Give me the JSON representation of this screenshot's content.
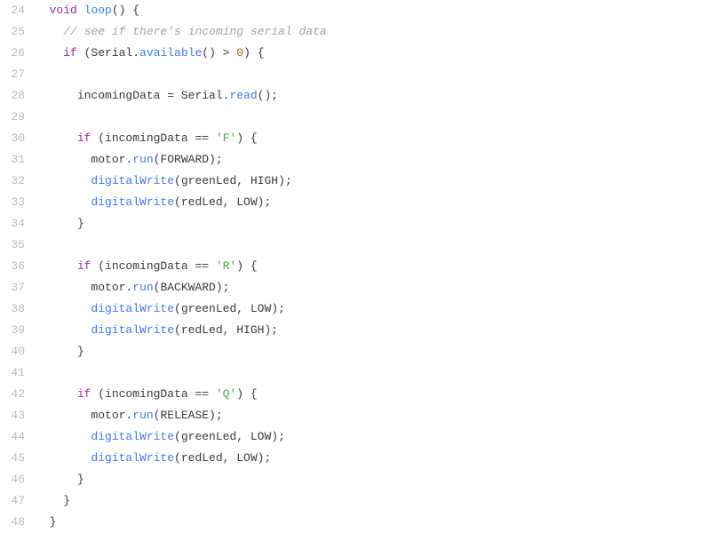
{
  "startLine": 24,
  "lines": [
    {
      "indent": 1,
      "tokens": [
        {
          "t": "type",
          "v": "void"
        },
        {
          "t": "plain",
          "v": " "
        },
        {
          "t": "function-name",
          "v": "loop"
        },
        {
          "t": "plain",
          "v": "() {"
        }
      ]
    },
    {
      "indent": 2,
      "tokens": [
        {
          "t": "comment",
          "v": "// see if there's incoming serial data"
        }
      ]
    },
    {
      "indent": 2,
      "tokens": [
        {
          "t": "keyword",
          "v": "if"
        },
        {
          "t": "plain",
          "v": " (Serial."
        },
        {
          "t": "method",
          "v": "available"
        },
        {
          "t": "plain",
          "v": "() > "
        },
        {
          "t": "number",
          "v": "0"
        },
        {
          "t": "plain",
          "v": ") {"
        }
      ]
    },
    {
      "indent": 0,
      "tokens": []
    },
    {
      "indent": 3,
      "tokens": [
        {
          "t": "plain",
          "v": "incomingData = Serial."
        },
        {
          "t": "method",
          "v": "read"
        },
        {
          "t": "plain",
          "v": "();"
        }
      ]
    },
    {
      "indent": 0,
      "tokens": []
    },
    {
      "indent": 3,
      "tokens": [
        {
          "t": "keyword",
          "v": "if"
        },
        {
          "t": "plain",
          "v": " (incomingData == "
        },
        {
          "t": "string",
          "v": "'F'"
        },
        {
          "t": "plain",
          "v": ") {"
        }
      ]
    },
    {
      "indent": 4,
      "tokens": [
        {
          "t": "plain",
          "v": "motor."
        },
        {
          "t": "method",
          "v": "run"
        },
        {
          "t": "plain",
          "v": "(FORWARD);"
        }
      ]
    },
    {
      "indent": 4,
      "tokens": [
        {
          "t": "method",
          "v": "digitalWrite"
        },
        {
          "t": "plain",
          "v": "(greenLed, HIGH);"
        }
      ]
    },
    {
      "indent": 4,
      "tokens": [
        {
          "t": "method",
          "v": "digitalWrite"
        },
        {
          "t": "plain",
          "v": "(redLed, LOW);"
        }
      ]
    },
    {
      "indent": 3,
      "tokens": [
        {
          "t": "plain",
          "v": "}"
        }
      ]
    },
    {
      "indent": 0,
      "tokens": []
    },
    {
      "indent": 3,
      "tokens": [
        {
          "t": "keyword",
          "v": "if"
        },
        {
          "t": "plain",
          "v": " (incomingData == "
        },
        {
          "t": "string",
          "v": "'R'"
        },
        {
          "t": "plain",
          "v": ") {"
        }
      ]
    },
    {
      "indent": 4,
      "tokens": [
        {
          "t": "plain",
          "v": "motor."
        },
        {
          "t": "method",
          "v": "run"
        },
        {
          "t": "plain",
          "v": "(BACKWARD);"
        }
      ]
    },
    {
      "indent": 4,
      "tokens": [
        {
          "t": "method",
          "v": "digitalWrite"
        },
        {
          "t": "plain",
          "v": "(greenLed, LOW);"
        }
      ]
    },
    {
      "indent": 4,
      "tokens": [
        {
          "t": "method",
          "v": "digitalWrite"
        },
        {
          "t": "plain",
          "v": "(redLed, HIGH);"
        }
      ]
    },
    {
      "indent": 3,
      "tokens": [
        {
          "t": "plain",
          "v": "}"
        }
      ]
    },
    {
      "indent": 0,
      "tokens": []
    },
    {
      "indent": 3,
      "tokens": [
        {
          "t": "keyword",
          "v": "if"
        },
        {
          "t": "plain",
          "v": " (incomingData == "
        },
        {
          "t": "string",
          "v": "'Q'"
        },
        {
          "t": "plain",
          "v": ") {"
        }
      ]
    },
    {
      "indent": 4,
      "tokens": [
        {
          "t": "plain",
          "v": "motor."
        },
        {
          "t": "method",
          "v": "run"
        },
        {
          "t": "plain",
          "v": "(RELEASE);"
        }
      ]
    },
    {
      "indent": 4,
      "tokens": [
        {
          "t": "method",
          "v": "digitalWrite"
        },
        {
          "t": "plain",
          "v": "(greenLed, LOW);"
        }
      ]
    },
    {
      "indent": 4,
      "tokens": [
        {
          "t": "method",
          "v": "digitalWrite"
        },
        {
          "t": "plain",
          "v": "(redLed, LOW);"
        }
      ]
    },
    {
      "indent": 3,
      "tokens": [
        {
          "t": "plain",
          "v": "}"
        }
      ]
    },
    {
      "indent": 2,
      "tokens": [
        {
          "t": "plain",
          "v": "}"
        }
      ]
    },
    {
      "indent": 1,
      "tokens": [
        {
          "t": "plain",
          "v": "}"
        }
      ]
    }
  ]
}
